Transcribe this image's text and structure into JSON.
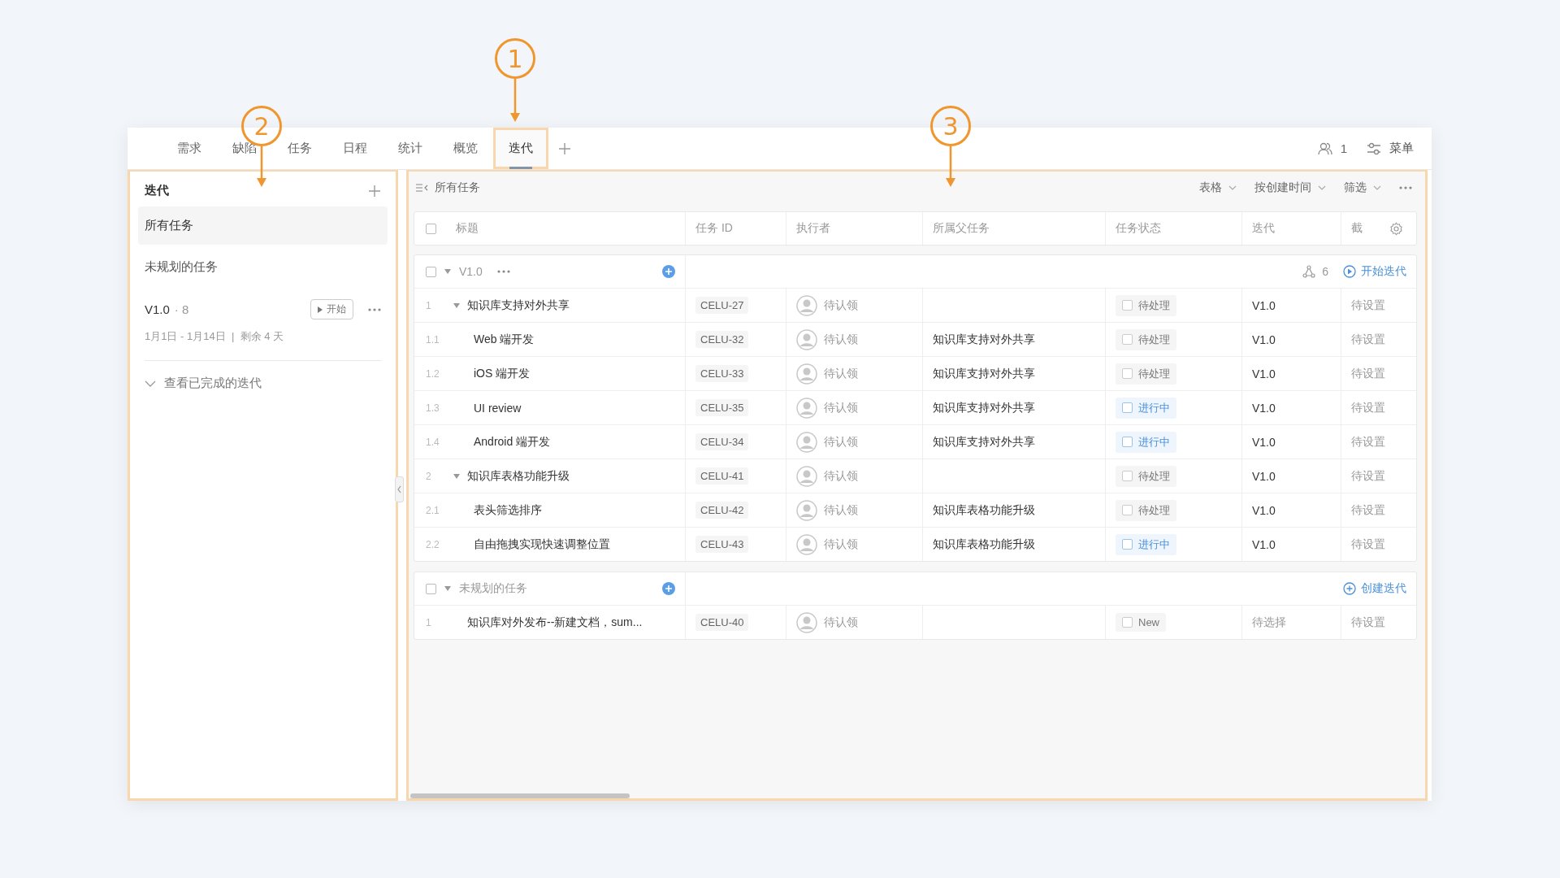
{
  "tabs": [
    {
      "label": "需求",
      "selected": false
    },
    {
      "label": "缺陷",
      "selected": false
    },
    {
      "label": "任务",
      "selected": false
    },
    {
      "label": "日程",
      "selected": false
    },
    {
      "label": "统计",
      "selected": false
    },
    {
      "label": "概览",
      "selected": false
    },
    {
      "label": "迭代",
      "selected": true
    }
  ],
  "header_right": {
    "members": "1",
    "menu": "菜单"
  },
  "sidebar": {
    "title": "迭代",
    "items": [
      {
        "label": "所有任务",
        "selected": true
      },
      {
        "label": "未规划的任务",
        "selected": false
      }
    ],
    "iteration": {
      "name": "V1.0",
      "count": "· 8",
      "start_button": "开始",
      "dates": "1月1日 - 1月14日  |  剩余 4 天"
    },
    "completed_toggle": {
      "label": "查看已完成的迭代",
      "expanded": false
    }
  },
  "main": {
    "title": "所有任务",
    "view": "表格",
    "sort": "按创建时间",
    "filter": "筛选",
    "table": {
      "all_checked": false,
      "columns": [
        "标题",
        "任务 ID",
        "执行者",
        "所属父任务",
        "任务状态",
        "迭代",
        "截"
      ],
      "groups": [
        {
          "kind": "iteration",
          "name": "V1.0",
          "checked": false,
          "expanded": true,
          "count": "6",
          "action": "开始迭代",
          "tasks": [
            {
              "num": "1",
              "title": "知识库支持对外共享",
              "id": "CELU-27",
              "assignee": "待认领",
              "status": {
                "label": "待处理",
                "kind": "todo"
              },
              "iteration": "V1.0",
              "deadline": "待设置",
              "expanded": true,
              "children": [
                {
                  "num": "1.1",
                  "title": "Web 端开发",
                  "id": "CELU-32",
                  "assignee": "待认领",
                  "parent": "知识库支持对外共享",
                  "status": {
                    "label": "待处理",
                    "kind": "todo"
                  },
                  "iteration": "V1.0",
                  "deadline": "待设置"
                },
                {
                  "num": "1.2",
                  "title": "iOS 端开发",
                  "id": "CELU-33",
                  "assignee": "待认领",
                  "parent": "知识库支持对外共享",
                  "status": {
                    "label": "待处理",
                    "kind": "todo"
                  },
                  "iteration": "V1.0",
                  "deadline": "待设置"
                },
                {
                  "num": "1.3",
                  "title": "UI review",
                  "id": "CELU-35",
                  "assignee": "待认领",
                  "parent": "知识库支持对外共享",
                  "status": {
                    "label": "进行中",
                    "kind": "doing"
                  },
                  "iteration": "V1.0",
                  "deadline": "待设置"
                },
                {
                  "num": "1.4",
                  "title": "Android 端开发",
                  "id": "CELU-34",
                  "assignee": "待认领",
                  "parent": "知识库支持对外共享",
                  "status": {
                    "label": "进行中",
                    "kind": "doing"
                  },
                  "iteration": "V1.0",
                  "deadline": "待设置"
                }
              ]
            },
            {
              "num": "2",
              "title": "知识库表格功能升级",
              "id": "CELU-41",
              "assignee": "待认领",
              "status": {
                "label": "待处理",
                "kind": "todo"
              },
              "iteration": "V1.0",
              "deadline": "待设置",
              "expanded": true,
              "children": [
                {
                  "num": "2.1",
                  "title": "表头筛选排序",
                  "id": "CELU-42",
                  "assignee": "待认领",
                  "parent": "知识库表格功能升级",
                  "status": {
                    "label": "待处理",
                    "kind": "todo"
                  },
                  "iteration": "V1.0",
                  "deadline": "待设置"
                },
                {
                  "num": "2.2",
                  "title": "自由拖拽实现快速调整位置",
                  "id": "CELU-43",
                  "assignee": "待认领",
                  "parent": "知识库表格功能升级",
                  "status": {
                    "label": "进行中",
                    "kind": "doing"
                  },
                  "iteration": "V1.0",
                  "deadline": "待设置"
                }
              ]
            }
          ]
        },
        {
          "kind": "backlog",
          "name": "未规划的任务",
          "checked": false,
          "expanded": true,
          "action": "创建迭代",
          "tasks": [
            {
              "num": "1",
              "title": "知识库对外发布--新建文档，sum...",
              "id": "CELU-40",
              "assignee": "待认领",
              "status": {
                "label": "New",
                "kind": "todo"
              },
              "iteration": "待选择",
              "deadline": "待设置"
            }
          ]
        }
      ]
    }
  },
  "callouts": [
    {
      "label": "1"
    },
    {
      "label": "2"
    },
    {
      "label": "3"
    }
  ]
}
